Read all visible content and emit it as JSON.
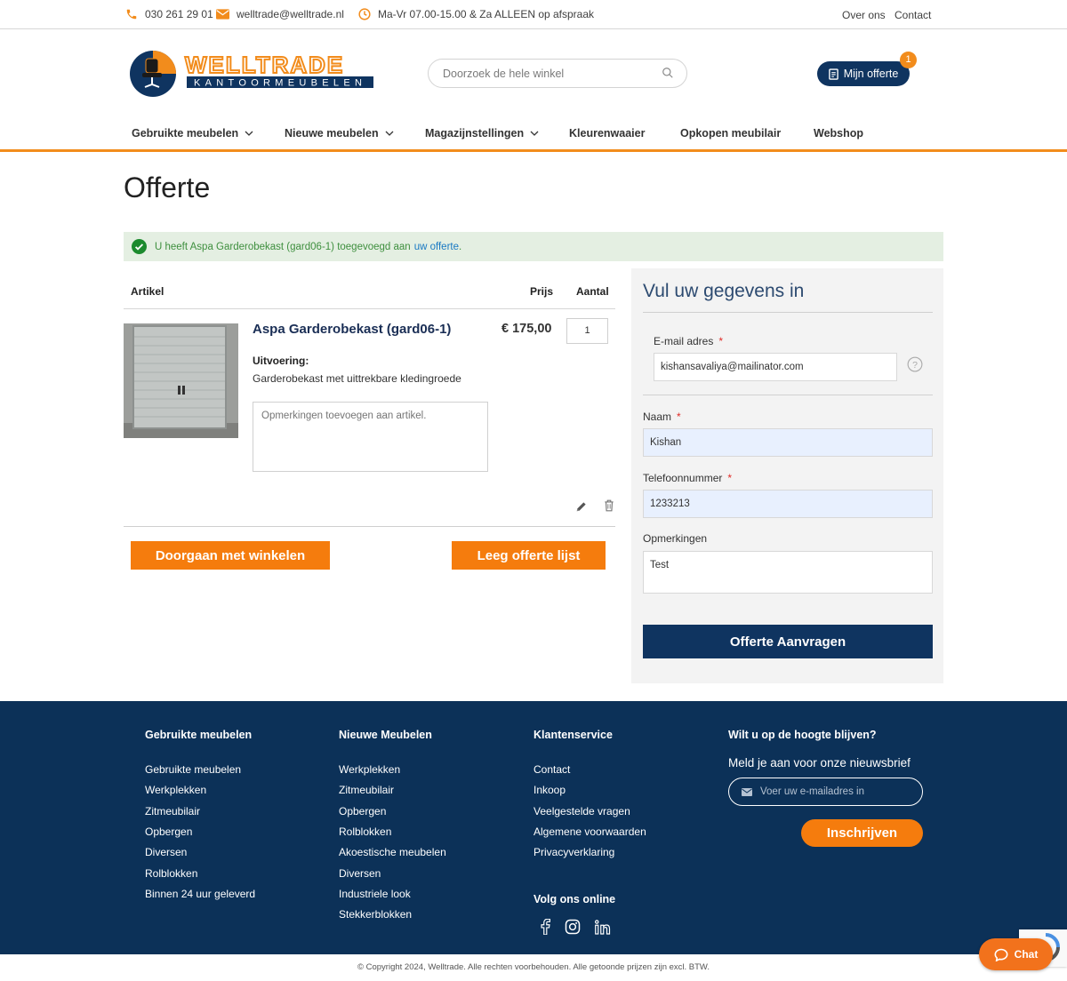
{
  "topbar": {
    "phone": "030 261 29 01",
    "email": "welltrade@welltrade.nl",
    "hours": "Ma-Vr 07.00-15.00 & Za ALLEEN op afspraak",
    "links": [
      "Over ons",
      "Contact"
    ]
  },
  "header": {
    "logo_text": "WELLTRADE",
    "logo_subtext": "KANTOORMEUBELEN",
    "search_placeholder": "Doorzoek de hele winkel",
    "offerte_label": "Mijn offerte",
    "offerte_count": "1"
  },
  "nav": {
    "items": [
      "Gebruikte meubelen",
      "Nieuwe meubelen",
      "Magazijnstellingen",
      "Kleurenwaaier",
      "Opkopen meubilair",
      "Webshop"
    ]
  },
  "page_title": "Offerte",
  "message": {
    "text": "U heeft Aspa Garderobekast (gard06-1) toegevoegd aan",
    "link": "uw offerte",
    "suffix": "."
  },
  "cart": {
    "headers": {
      "article": "Artikel",
      "price": "Prijs",
      "qty": "Aantal"
    },
    "item": {
      "name": "Aspa Garderobekast (gard06-1)",
      "price": "€ 175,00",
      "qty": "1",
      "option_label": "Uitvoering:",
      "option_value": "Garderobekast met uittrekbare kledingroede",
      "remark_placeholder": "Opmerkingen toevoegen aan artikel."
    },
    "continue_label": "Doorgaan met winkelen",
    "clear_label": "Leeg offerte lijst"
  },
  "form": {
    "title": "Vul uw gegevens in",
    "email_label": "E-mail adres",
    "email_value": "kishansavaliya@mailinator.com",
    "name_label": "Naam",
    "name_value": "Kishan",
    "phone_label": "Telefoonnummer",
    "phone_value": "1233213",
    "remarks_label": "Opmerkingen",
    "remarks_value": "Test",
    "required_mark": "*",
    "submit_label": "Offerte Aanvragen"
  },
  "footer": {
    "col1": {
      "title": "Gebruikte meubelen",
      "links": [
        "Gebruikte meubelen",
        "Werkplekken",
        "Zitmeubilair",
        "Opbergen",
        "Diversen",
        "Rolblokken",
        "Binnen 24 uur geleverd"
      ]
    },
    "col2": {
      "title": "Nieuwe Meubelen",
      "links": [
        "Werkplekken",
        "Zitmeubilair",
        "Opbergen",
        "Rolblokken",
        "Akoestische meubelen",
        "Diversen",
        "Industriele look",
        "Stekkerblokken"
      ]
    },
    "col3": {
      "title": "Klantenservice",
      "links": [
        "Contact",
        "Inkoop",
        "Veelgestelde vragen",
        "Algemene voorwaarden",
        "Privacyverklaring"
      ]
    },
    "social_title": "Volg ons online",
    "col4": {
      "title": "Wilt u op de hoogte blijven?",
      "text": "Meld je aan voor onze nieuwsbrief",
      "placeholder": "Voer uw e-mailadres in",
      "button": "Inschrijven"
    },
    "copyright": "© Copyright 2024, Welltrade. Alle rechten voorbehouden. Alle getoonde prijzen zijn excl. BTW."
  },
  "chat_label": "Chat",
  "colors": {
    "orange": "#f57c0d",
    "navy": "#0f3460",
    "footer": "#0c3158"
  }
}
